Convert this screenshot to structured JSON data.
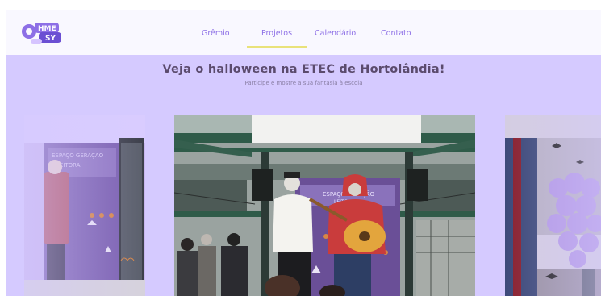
{
  "header": {
    "logo_alt": "logo",
    "nav": [
      {
        "label": "Grêmio",
        "active": false
      },
      {
        "label": "Projetos",
        "active": true
      },
      {
        "label": "Calendário",
        "active": false
      },
      {
        "label": "Contato",
        "active": false
      }
    ]
  },
  "hero": {
    "title": "Veja o halloween na ETEC de Hortolândia!",
    "subtitle": "Participe e mostre a sua fantasia à escola"
  },
  "carousel": {
    "left_sign": "ESPAÇO GERAÇÃO LEITORA",
    "center_banner": "ESPAÇO GERAÇÃO LEITORA"
  },
  "colors": {
    "accent": "#8d6fe6",
    "hero_bg": "#d5caff",
    "underline": "#e9e27a"
  }
}
